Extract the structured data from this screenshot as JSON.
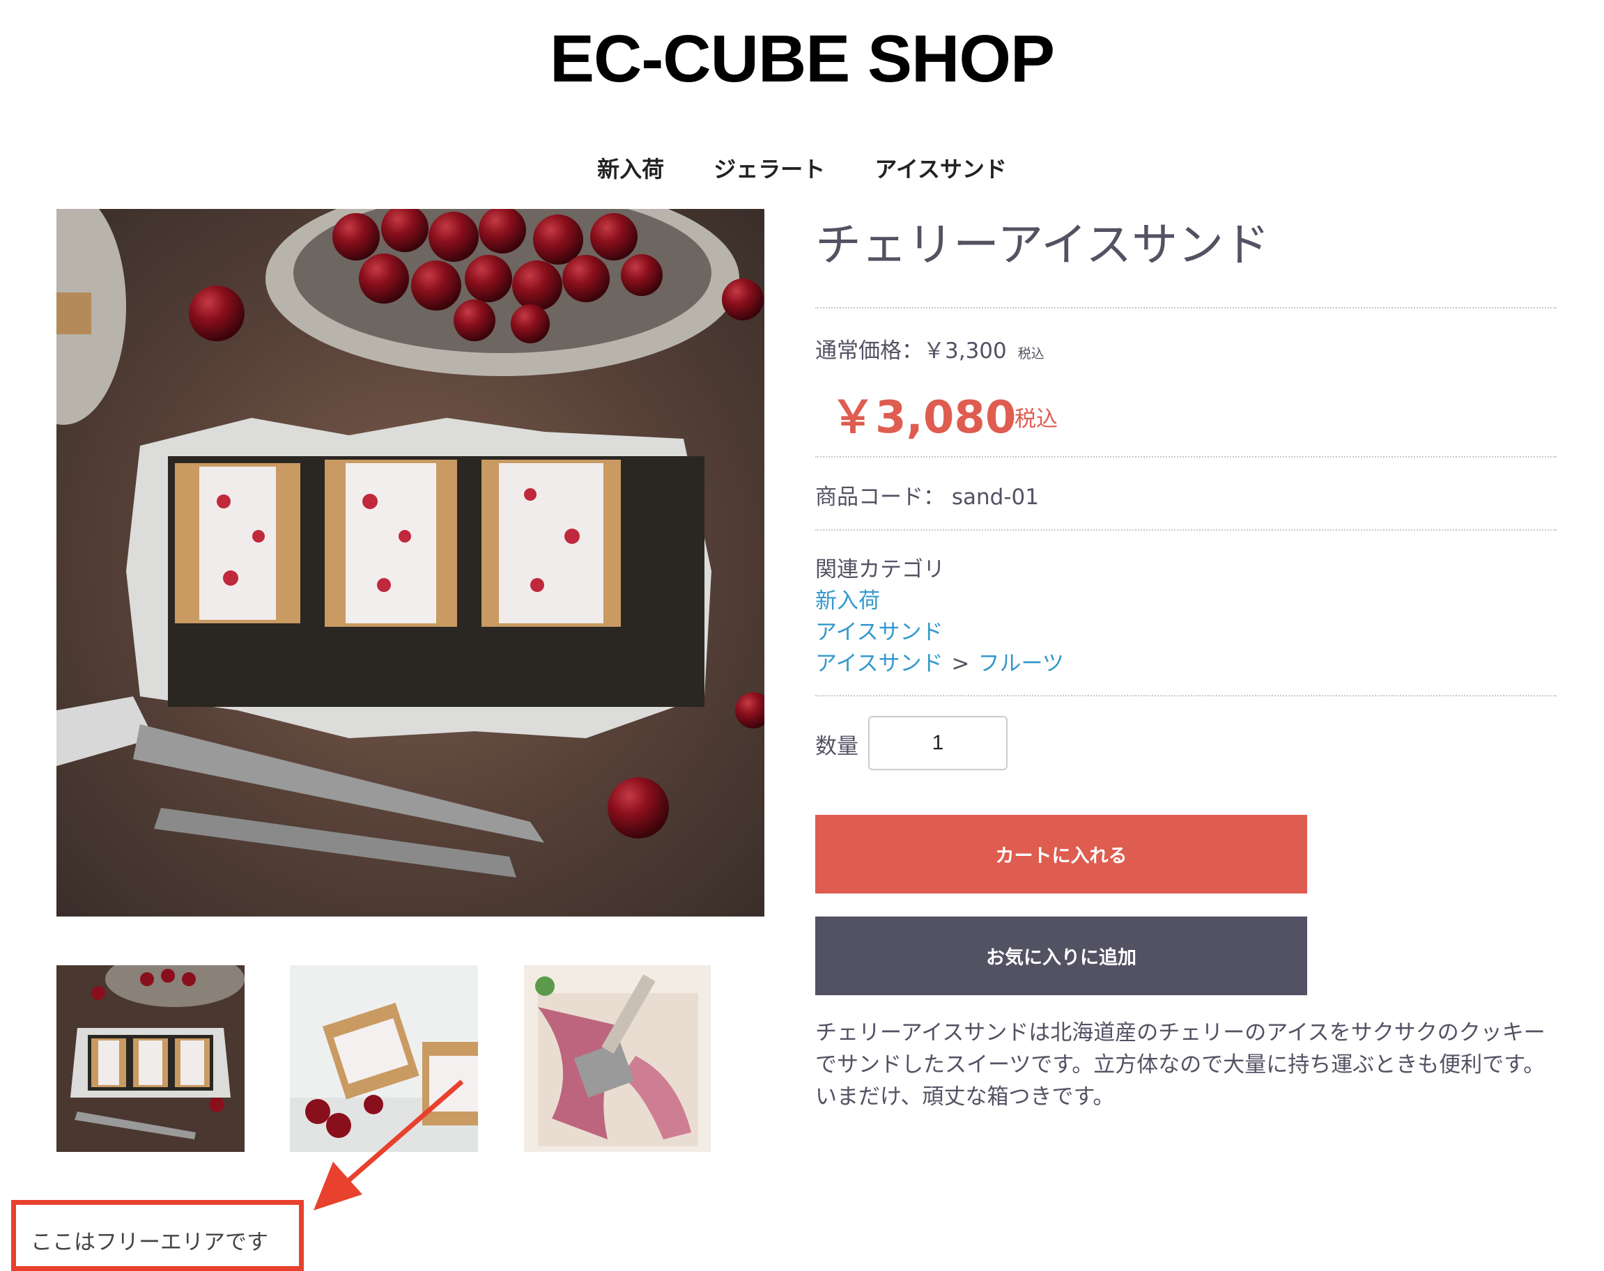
{
  "header": {
    "site_title": "EC-CUBE SHOP",
    "nav": [
      "新入荷",
      "ジェラート",
      "アイスサンド"
    ]
  },
  "images": {
    "main": "cherry-ice-sandwich-photo",
    "thumbnails": [
      "cherry-ice-sandwich-box-thumb",
      "ice-sandwich-stack-thumb",
      "cherry-ice-tray-thumb"
    ]
  },
  "product": {
    "name": "チェリーアイスサンド",
    "normal_price_label": "通常価格：",
    "normal_price": "￥3,300",
    "normal_price_tax": "税込",
    "sale_price": "￥3,080",
    "sale_price_tax": "税込",
    "code_label": "商品コード：",
    "code": "sand-01",
    "category_heading": "関連カテゴリ",
    "categories": [
      {
        "label": "新入荷"
      },
      {
        "label": "アイスサンド"
      },
      {
        "parent": "アイスサンド",
        "separator": ">",
        "child": "フルーツ"
      }
    ],
    "quantity_label": "数量",
    "quantity_value": "1",
    "add_to_cart_label": "カートに入れる",
    "add_to_favorite_label": "お気に入りに追加",
    "description_lines": [
      "チェリーアイスサンドは北海道産のチェリーのアイスをサクサクのクッキーでサンドしたスイーツです。立方体なので大量に持ち運ぶときも便利です。",
      "いまだけ、頑丈な箱つきです。"
    ]
  },
  "free_area": {
    "text": "ここはフリーエリアです"
  },
  "colors": {
    "accent_price": "#de5d50",
    "cart_button": "#de5d50",
    "favorite_button": "#525263",
    "link": "#3399cc",
    "annotation": "#e8412e"
  }
}
